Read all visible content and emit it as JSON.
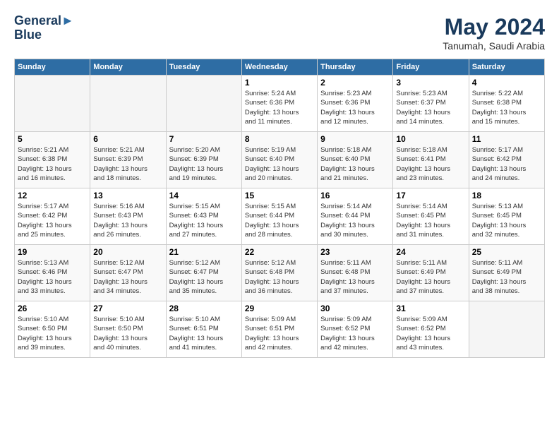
{
  "header": {
    "logo_line1": "General",
    "logo_line2": "Blue",
    "month_year": "May 2024",
    "location": "Tanumah, Saudi Arabia"
  },
  "weekdays": [
    "Sunday",
    "Monday",
    "Tuesday",
    "Wednesday",
    "Thursday",
    "Friday",
    "Saturday"
  ],
  "weeks": [
    [
      {
        "day": "",
        "info": ""
      },
      {
        "day": "",
        "info": ""
      },
      {
        "day": "",
        "info": ""
      },
      {
        "day": "1",
        "info": "Sunrise: 5:24 AM\nSunset: 6:36 PM\nDaylight: 13 hours\nand 11 minutes."
      },
      {
        "day": "2",
        "info": "Sunrise: 5:23 AM\nSunset: 6:36 PM\nDaylight: 13 hours\nand 12 minutes."
      },
      {
        "day": "3",
        "info": "Sunrise: 5:23 AM\nSunset: 6:37 PM\nDaylight: 13 hours\nand 14 minutes."
      },
      {
        "day": "4",
        "info": "Sunrise: 5:22 AM\nSunset: 6:38 PM\nDaylight: 13 hours\nand 15 minutes."
      }
    ],
    [
      {
        "day": "5",
        "info": "Sunrise: 5:21 AM\nSunset: 6:38 PM\nDaylight: 13 hours\nand 16 minutes."
      },
      {
        "day": "6",
        "info": "Sunrise: 5:21 AM\nSunset: 6:39 PM\nDaylight: 13 hours\nand 18 minutes."
      },
      {
        "day": "7",
        "info": "Sunrise: 5:20 AM\nSunset: 6:39 PM\nDaylight: 13 hours\nand 19 minutes."
      },
      {
        "day": "8",
        "info": "Sunrise: 5:19 AM\nSunset: 6:40 PM\nDaylight: 13 hours\nand 20 minutes."
      },
      {
        "day": "9",
        "info": "Sunrise: 5:18 AM\nSunset: 6:40 PM\nDaylight: 13 hours\nand 21 minutes."
      },
      {
        "day": "10",
        "info": "Sunrise: 5:18 AM\nSunset: 6:41 PM\nDaylight: 13 hours\nand 23 minutes."
      },
      {
        "day": "11",
        "info": "Sunrise: 5:17 AM\nSunset: 6:42 PM\nDaylight: 13 hours\nand 24 minutes."
      }
    ],
    [
      {
        "day": "12",
        "info": "Sunrise: 5:17 AM\nSunset: 6:42 PM\nDaylight: 13 hours\nand 25 minutes."
      },
      {
        "day": "13",
        "info": "Sunrise: 5:16 AM\nSunset: 6:43 PM\nDaylight: 13 hours\nand 26 minutes."
      },
      {
        "day": "14",
        "info": "Sunrise: 5:15 AM\nSunset: 6:43 PM\nDaylight: 13 hours\nand 27 minutes."
      },
      {
        "day": "15",
        "info": "Sunrise: 5:15 AM\nSunset: 6:44 PM\nDaylight: 13 hours\nand 28 minutes."
      },
      {
        "day": "16",
        "info": "Sunrise: 5:14 AM\nSunset: 6:44 PM\nDaylight: 13 hours\nand 30 minutes."
      },
      {
        "day": "17",
        "info": "Sunrise: 5:14 AM\nSunset: 6:45 PM\nDaylight: 13 hours\nand 31 minutes."
      },
      {
        "day": "18",
        "info": "Sunrise: 5:13 AM\nSunset: 6:45 PM\nDaylight: 13 hours\nand 32 minutes."
      }
    ],
    [
      {
        "day": "19",
        "info": "Sunrise: 5:13 AM\nSunset: 6:46 PM\nDaylight: 13 hours\nand 33 minutes."
      },
      {
        "day": "20",
        "info": "Sunrise: 5:12 AM\nSunset: 6:47 PM\nDaylight: 13 hours\nand 34 minutes."
      },
      {
        "day": "21",
        "info": "Sunrise: 5:12 AM\nSunset: 6:47 PM\nDaylight: 13 hours\nand 35 minutes."
      },
      {
        "day": "22",
        "info": "Sunrise: 5:12 AM\nSunset: 6:48 PM\nDaylight: 13 hours\nand 36 minutes."
      },
      {
        "day": "23",
        "info": "Sunrise: 5:11 AM\nSunset: 6:48 PM\nDaylight: 13 hours\nand 37 minutes."
      },
      {
        "day": "24",
        "info": "Sunrise: 5:11 AM\nSunset: 6:49 PM\nDaylight: 13 hours\nand 37 minutes."
      },
      {
        "day": "25",
        "info": "Sunrise: 5:11 AM\nSunset: 6:49 PM\nDaylight: 13 hours\nand 38 minutes."
      }
    ],
    [
      {
        "day": "26",
        "info": "Sunrise: 5:10 AM\nSunset: 6:50 PM\nDaylight: 13 hours\nand 39 minutes."
      },
      {
        "day": "27",
        "info": "Sunrise: 5:10 AM\nSunset: 6:50 PM\nDaylight: 13 hours\nand 40 minutes."
      },
      {
        "day": "28",
        "info": "Sunrise: 5:10 AM\nSunset: 6:51 PM\nDaylight: 13 hours\nand 41 minutes."
      },
      {
        "day": "29",
        "info": "Sunrise: 5:09 AM\nSunset: 6:51 PM\nDaylight: 13 hours\nand 42 minutes."
      },
      {
        "day": "30",
        "info": "Sunrise: 5:09 AM\nSunset: 6:52 PM\nDaylight: 13 hours\nand 42 minutes."
      },
      {
        "day": "31",
        "info": "Sunrise: 5:09 AM\nSunset: 6:52 PM\nDaylight: 13 hours\nand 43 minutes."
      },
      {
        "day": "",
        "info": ""
      }
    ]
  ]
}
